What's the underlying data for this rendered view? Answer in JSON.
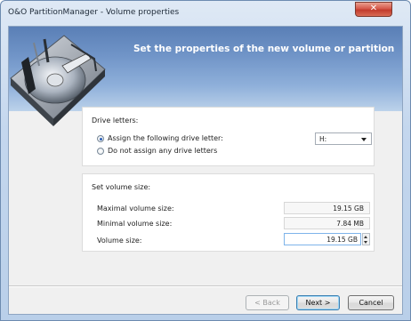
{
  "window": {
    "title": "O&O PartitionManager - Volume properties",
    "close_label": "✕"
  },
  "header": {
    "title": "Set the properties of the new volume or partition"
  },
  "drive_letters": {
    "heading": "Drive letters:",
    "assign_label": "Assign the following drive letter:",
    "no_assign_label": "Do not assign any drive letters",
    "selected": "assign",
    "letter_value": "H:"
  },
  "volume_size": {
    "heading": "Set volume size:",
    "max_label": "Maximal volume size:",
    "max_value": "19.15 GB",
    "min_label": "Minimal volume size:",
    "min_value": "7.84 MB",
    "size_label": "Volume size:",
    "size_value": "19.15 GB"
  },
  "buttons": {
    "back": "< Back",
    "next": "Next >",
    "cancel": "Cancel"
  },
  "colors": {
    "header_top": "#5a7fb6",
    "header_bottom": "#bcd2ea",
    "close_red": "#c23b2c",
    "accent_blue": "#3c7fb1"
  },
  "icons": {
    "header_art": "hard-disk-drive-illustration",
    "spin": "spinner-arrows-icon",
    "dropdown": "chevron-down-icon"
  }
}
